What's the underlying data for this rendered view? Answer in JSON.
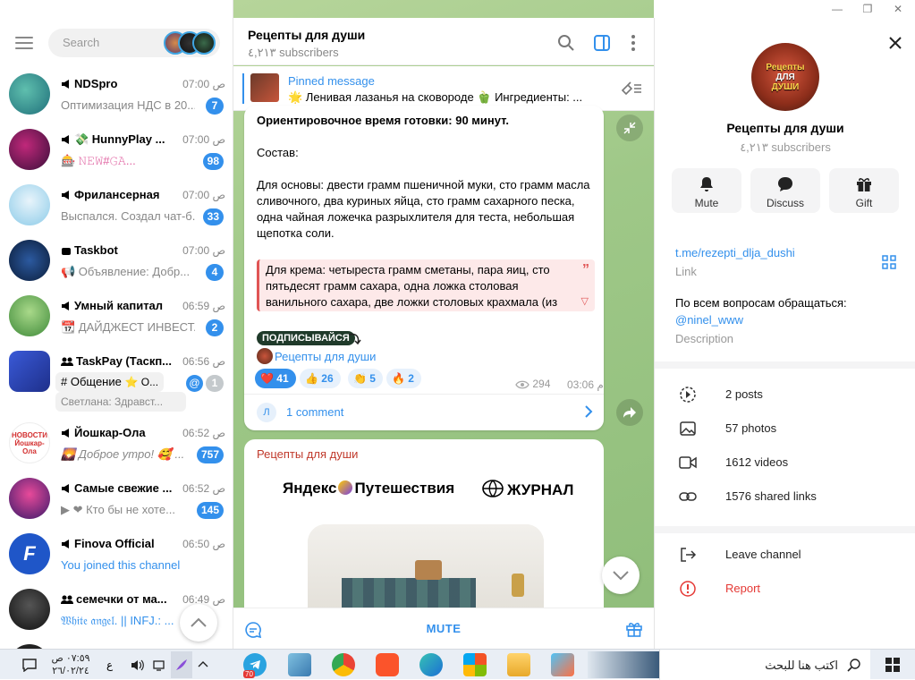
{
  "sidebar": {
    "search_placeholder": "Search",
    "chats": [
      {
        "name": "NDSpro",
        "time": "07:00 ص",
        "preview": "Оптимизация НДС в 20...",
        "badge": "7"
      },
      {
        "name": "💸 HunnyPlay ...",
        "time": "07:00 ص",
        "preview": "🎰 𝙽𝙴𝚆#𝙶𝙰...",
        "badge": "98"
      },
      {
        "name": "Фрилансерная",
        "time": "07:00 ص",
        "preview": "Выспался. Создал чат-б...",
        "badge": "33"
      },
      {
        "name": "Taskbot",
        "time": "07:00 ص",
        "preview": "📢 Объявление:  Добр...",
        "badge": "4"
      },
      {
        "name": "Умный капитал",
        "time": "06:59 ص",
        "preview": "📆 ДАЙДЖЕСТ ИНВЕСТ...",
        "badge": "2"
      },
      {
        "name": "TaskPay (Таскп...",
        "time": "06:56 ص",
        "topic": "# Общение",
        "topic_extra": "⭐ О...",
        "preview": "Светлана: Здравст...",
        "badge": "1"
      },
      {
        "name": "Йошкар-Ола",
        "time": "06:52 ص",
        "preview": "🌄 Доброе утро! 🥰 ...",
        "badge": "757"
      },
      {
        "name": "Самые свежие ...",
        "time": "06:52 ص",
        "preview": "▶ ❤ Кто бы не хоте...",
        "badge": "145"
      },
      {
        "name": "Finova Official",
        "time": "06:50 ص",
        "preview": "You joined this channel",
        "badge": ""
      },
      {
        "name": "семечки от ма...",
        "time": "06:49 ص",
        "preview": "𝔚𝔥𝔦𝔱𝔢 𝔞𝔫𝔤𝔢𝔩. || INFJ.: ...",
        "badge": ""
      }
    ]
  },
  "chat": {
    "title": "Рецепты для души",
    "subscribers": "٤,٢١٣ subscribers",
    "pinned_title": "Pinned message",
    "pinned_text": "🌟 Ленивая лазанья на сковороде 🫑 Ингредиенты: ...",
    "message": {
      "line1": "Ориентировочное время готовки: 90 минут.",
      "line2": "Состав:",
      "line3": "Для основы: двести грамм пшеничной муки, сто грамм масла сливочного, два куриных яйца, сто грамм сахарного песка, одна чайная ложечка разрыхлителя для теста, небольшая щепотка соли.",
      "quote": "Для крема: четыреста грамм сметаны, пара яиц, сто пятьдесят грамм сахара, одна ложка столовая ванильного сахара, две ложки столовых крахмала (из",
      "subscribe": "ПОДПИСЫВАЙСЯ",
      "channel_link": "Рецепты для души",
      "reactions": [
        {
          "emoji": "❤️",
          "count": "41"
        },
        {
          "emoji": "👍",
          "count": "26"
        },
        {
          "emoji": "👏",
          "count": "5"
        },
        {
          "emoji": "🔥",
          "count": "2"
        }
      ],
      "views": "294",
      "time": "03:06 م",
      "comment_avatar": "Л",
      "comments": "1 comment"
    },
    "message2": {
      "author": "Рецепты для души",
      "logo1": "Яндекс",
      "logo1b": "Путешествия",
      "logo2": "ЖУРНАЛ"
    },
    "mute_label": "MUTE"
  },
  "profile": {
    "avatar_text_1": "Рецепты",
    "avatar_text_2": "ДЛЯ",
    "avatar_text_3": "ДУШИ",
    "name": "Рецепты для души",
    "subscribers": "٤,٢١٣ subscribers",
    "buttons": {
      "mute": "Mute",
      "discuss": "Discuss",
      "gift": "Gift"
    },
    "link": "t.me/rezepti_dlja_dushi",
    "link_label": "Link",
    "description": "По всем вопросам обращаться:",
    "description_handle": "@ninel_www",
    "description_label": "Description",
    "stats": {
      "posts": "2 posts",
      "photos": "57 photos",
      "videos": "1612 videos",
      "links": "1576 shared links"
    },
    "leave": "Leave channel",
    "report": "Report"
  },
  "taskbar": {
    "time": "٠٧:٥٩ ص",
    "date": "٢٦/٠٢/٢٤",
    "lang": "ع",
    "search": "اكتب هنا للبحث",
    "telegram_badge": "70"
  },
  "colors": {
    "accent": "#3390ec",
    "danger": "#e53935",
    "chat_bg": "#9dc582"
  }
}
